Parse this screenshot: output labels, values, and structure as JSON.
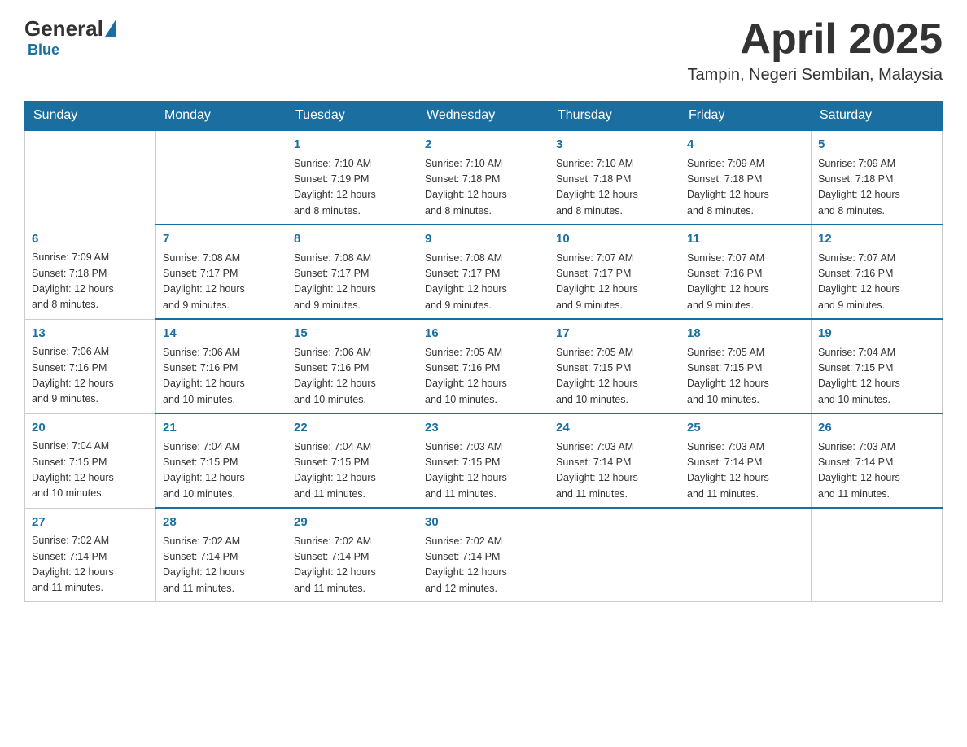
{
  "header": {
    "logo_general": "General",
    "logo_blue": "Blue",
    "month_year": "April 2025",
    "location": "Tampin, Negeri Sembilan, Malaysia"
  },
  "weekdays": [
    "Sunday",
    "Monday",
    "Tuesday",
    "Wednesday",
    "Thursday",
    "Friday",
    "Saturday"
  ],
  "weeks": [
    [
      {
        "day": "",
        "info": ""
      },
      {
        "day": "",
        "info": ""
      },
      {
        "day": "1",
        "info": "Sunrise: 7:10 AM\nSunset: 7:19 PM\nDaylight: 12 hours\nand 8 minutes."
      },
      {
        "day": "2",
        "info": "Sunrise: 7:10 AM\nSunset: 7:18 PM\nDaylight: 12 hours\nand 8 minutes."
      },
      {
        "day": "3",
        "info": "Sunrise: 7:10 AM\nSunset: 7:18 PM\nDaylight: 12 hours\nand 8 minutes."
      },
      {
        "day": "4",
        "info": "Sunrise: 7:09 AM\nSunset: 7:18 PM\nDaylight: 12 hours\nand 8 minutes."
      },
      {
        "day": "5",
        "info": "Sunrise: 7:09 AM\nSunset: 7:18 PM\nDaylight: 12 hours\nand 8 minutes."
      }
    ],
    [
      {
        "day": "6",
        "info": "Sunrise: 7:09 AM\nSunset: 7:18 PM\nDaylight: 12 hours\nand 8 minutes."
      },
      {
        "day": "7",
        "info": "Sunrise: 7:08 AM\nSunset: 7:17 PM\nDaylight: 12 hours\nand 9 minutes."
      },
      {
        "day": "8",
        "info": "Sunrise: 7:08 AM\nSunset: 7:17 PM\nDaylight: 12 hours\nand 9 minutes."
      },
      {
        "day": "9",
        "info": "Sunrise: 7:08 AM\nSunset: 7:17 PM\nDaylight: 12 hours\nand 9 minutes."
      },
      {
        "day": "10",
        "info": "Sunrise: 7:07 AM\nSunset: 7:17 PM\nDaylight: 12 hours\nand 9 minutes."
      },
      {
        "day": "11",
        "info": "Sunrise: 7:07 AM\nSunset: 7:16 PM\nDaylight: 12 hours\nand 9 minutes."
      },
      {
        "day": "12",
        "info": "Sunrise: 7:07 AM\nSunset: 7:16 PM\nDaylight: 12 hours\nand 9 minutes."
      }
    ],
    [
      {
        "day": "13",
        "info": "Sunrise: 7:06 AM\nSunset: 7:16 PM\nDaylight: 12 hours\nand 9 minutes."
      },
      {
        "day": "14",
        "info": "Sunrise: 7:06 AM\nSunset: 7:16 PM\nDaylight: 12 hours\nand 10 minutes."
      },
      {
        "day": "15",
        "info": "Sunrise: 7:06 AM\nSunset: 7:16 PM\nDaylight: 12 hours\nand 10 minutes."
      },
      {
        "day": "16",
        "info": "Sunrise: 7:05 AM\nSunset: 7:16 PM\nDaylight: 12 hours\nand 10 minutes."
      },
      {
        "day": "17",
        "info": "Sunrise: 7:05 AM\nSunset: 7:15 PM\nDaylight: 12 hours\nand 10 minutes."
      },
      {
        "day": "18",
        "info": "Sunrise: 7:05 AM\nSunset: 7:15 PM\nDaylight: 12 hours\nand 10 minutes."
      },
      {
        "day": "19",
        "info": "Sunrise: 7:04 AM\nSunset: 7:15 PM\nDaylight: 12 hours\nand 10 minutes."
      }
    ],
    [
      {
        "day": "20",
        "info": "Sunrise: 7:04 AM\nSunset: 7:15 PM\nDaylight: 12 hours\nand 10 minutes."
      },
      {
        "day": "21",
        "info": "Sunrise: 7:04 AM\nSunset: 7:15 PM\nDaylight: 12 hours\nand 10 minutes."
      },
      {
        "day": "22",
        "info": "Sunrise: 7:04 AM\nSunset: 7:15 PM\nDaylight: 12 hours\nand 11 minutes."
      },
      {
        "day": "23",
        "info": "Sunrise: 7:03 AM\nSunset: 7:15 PM\nDaylight: 12 hours\nand 11 minutes."
      },
      {
        "day": "24",
        "info": "Sunrise: 7:03 AM\nSunset: 7:14 PM\nDaylight: 12 hours\nand 11 minutes."
      },
      {
        "day": "25",
        "info": "Sunrise: 7:03 AM\nSunset: 7:14 PM\nDaylight: 12 hours\nand 11 minutes."
      },
      {
        "day": "26",
        "info": "Sunrise: 7:03 AM\nSunset: 7:14 PM\nDaylight: 12 hours\nand 11 minutes."
      }
    ],
    [
      {
        "day": "27",
        "info": "Sunrise: 7:02 AM\nSunset: 7:14 PM\nDaylight: 12 hours\nand 11 minutes."
      },
      {
        "day": "28",
        "info": "Sunrise: 7:02 AM\nSunset: 7:14 PM\nDaylight: 12 hours\nand 11 minutes."
      },
      {
        "day": "29",
        "info": "Sunrise: 7:02 AM\nSunset: 7:14 PM\nDaylight: 12 hours\nand 11 minutes."
      },
      {
        "day": "30",
        "info": "Sunrise: 7:02 AM\nSunset: 7:14 PM\nDaylight: 12 hours\nand 12 minutes."
      },
      {
        "day": "",
        "info": ""
      },
      {
        "day": "",
        "info": ""
      },
      {
        "day": "",
        "info": ""
      }
    ]
  ]
}
